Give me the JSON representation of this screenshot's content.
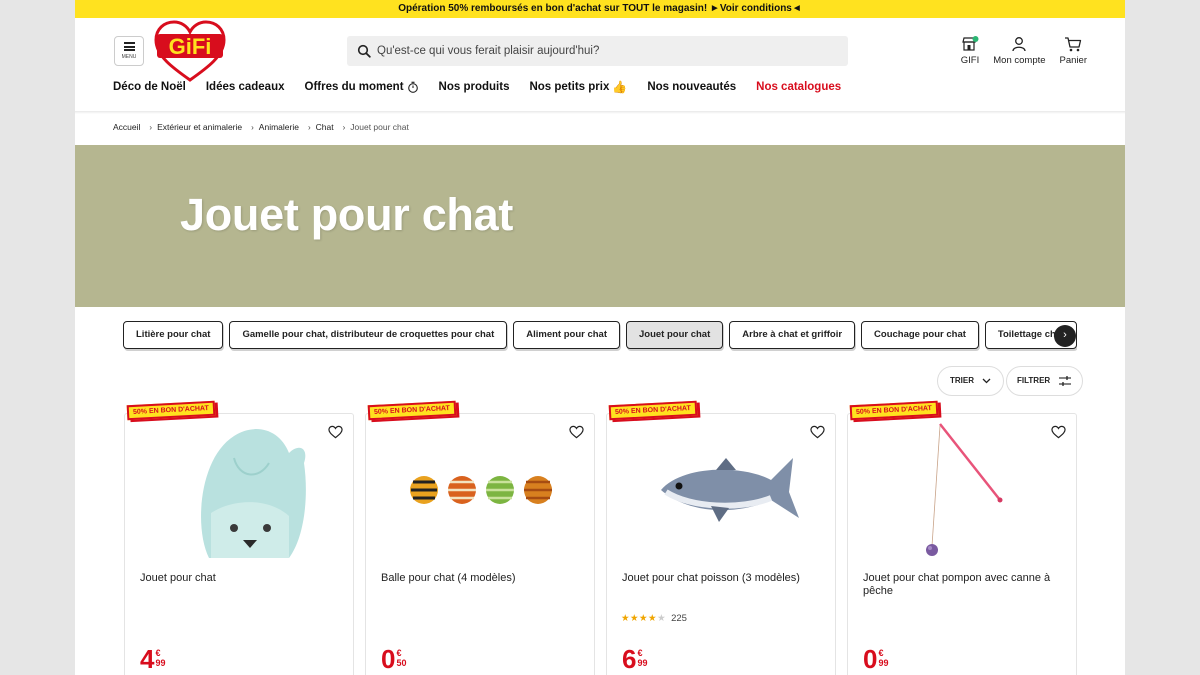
{
  "promo": {
    "text": "Opération 50% remboursés en bon d'achat sur TOUT le magasin! ►Voir conditions◄"
  },
  "header": {
    "menu_label": "MENU",
    "logo_text": "GiFi",
    "search_placeholder": "Qu'est-ce qui vous ferait plaisir aujourd'hui?",
    "icons": [
      {
        "label": "GIFI",
        "icon": "store-icon"
      },
      {
        "label": "Mon compte",
        "icon": "user-icon"
      },
      {
        "label": "Panier",
        "icon": "cart-icon"
      }
    ]
  },
  "nav": {
    "items": [
      {
        "label": "Déco de Noël"
      },
      {
        "label": "Idées cadeaux"
      },
      {
        "label": "Offres du moment",
        "icon": "stopwatch-icon"
      },
      {
        "label": "Nos produits"
      },
      {
        "label": "Nos petits prix",
        "icon": "thumbs-up-icon"
      },
      {
        "label": "Nos nouveautés"
      },
      {
        "label": "Nos catalogues",
        "highlight": "#d80d1d"
      }
    ]
  },
  "breadcrumb": [
    "Accueil",
    "Extérieur et animalerie",
    "Animalerie",
    "Chat",
    "Jouet pour chat"
  ],
  "banner": {
    "title": "Jouet pour chat",
    "background": "#b5b690"
  },
  "categories": {
    "items": [
      {
        "label": "Litière pour chat",
        "active": false
      },
      {
        "label": "Gamelle pour chat, distributeur de croquettes pour chat",
        "active": false
      },
      {
        "label": "Aliment pour chat",
        "active": false
      },
      {
        "label": "Jouet pour chat",
        "active": true
      },
      {
        "label": "Arbre à chat et griffoir",
        "active": false
      },
      {
        "label": "Couchage pour chat",
        "active": false
      },
      {
        "label": "Toilettage chat",
        "active": false
      }
    ]
  },
  "toolbar": {
    "sort_label": "TRIER",
    "filter_label": "FILTRER"
  },
  "products": [
    {
      "badge": "50% EN BON D'ACHAT",
      "name": "Jouet pour chat",
      "price_int": "4",
      "price_currency": "€",
      "price_dec": "99",
      "image": "hooded-cat-bed-toy"
    },
    {
      "badge": "50% EN BON D'ACHAT",
      "name": "Balle pour chat (4 modèles)",
      "price_int": "0",
      "price_currency": "€",
      "price_dec": "50",
      "image": "striped-balls"
    },
    {
      "badge": "50% EN BON D'ACHAT",
      "name": "Jouet pour chat poisson (3 modèles)",
      "rating": 4,
      "reviews": "225",
      "price_int": "6",
      "price_currency": "€",
      "price_dec": "99",
      "image": "fish-toy"
    },
    {
      "badge": "50% EN BON D'ACHAT",
      "name": "Jouet pour chat pompon avec canne à pêche",
      "price_int": "0",
      "price_currency": "€",
      "price_dec": "99",
      "image": "fishing-rod-pompom"
    }
  ],
  "colors": {
    "promo_bar": "#ffe21f",
    "accent_red": "#d80d1d"
  }
}
